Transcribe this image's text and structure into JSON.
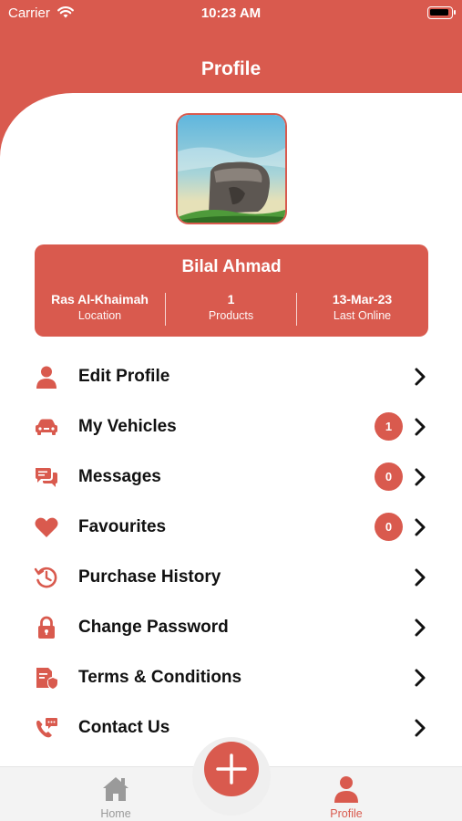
{
  "status_bar": {
    "carrier": "Carrier",
    "time": "10:23 AM"
  },
  "header": {
    "title": "Profile"
  },
  "profile": {
    "name": "Bilal Ahmad",
    "stats": [
      {
        "value": "Ras Al-Khaimah",
        "label": "Location"
      },
      {
        "value": "1",
        "label": "Products"
      },
      {
        "value": "13-Mar-23",
        "label": "Last Online"
      }
    ]
  },
  "menu": {
    "items": [
      {
        "label": "Edit Profile",
        "icon": "user-icon"
      },
      {
        "label": "My Vehicles",
        "icon": "car-icon",
        "badge": "1"
      },
      {
        "label": "Messages",
        "icon": "chat-icon",
        "badge": "0"
      },
      {
        "label": "Favourites",
        "icon": "heart-icon",
        "badge": "0"
      },
      {
        "label": "Purchase History",
        "icon": "history-icon"
      },
      {
        "label": "Change Password",
        "icon": "lock-icon"
      },
      {
        "label": "Terms & Conditions",
        "icon": "document-shield-icon"
      },
      {
        "label": "Contact Us",
        "icon": "phone-chat-icon"
      }
    ]
  },
  "tab_bar": {
    "tabs": [
      {
        "label": "Home",
        "icon": "home-icon",
        "active": false
      },
      {
        "label": "Profile",
        "icon": "user-icon",
        "active": true
      }
    ],
    "fab_icon": "plus-icon"
  },
  "colors": {
    "accent": "#d95a4e",
    "inactive": "#9a9a9a",
    "text": "#111111"
  }
}
